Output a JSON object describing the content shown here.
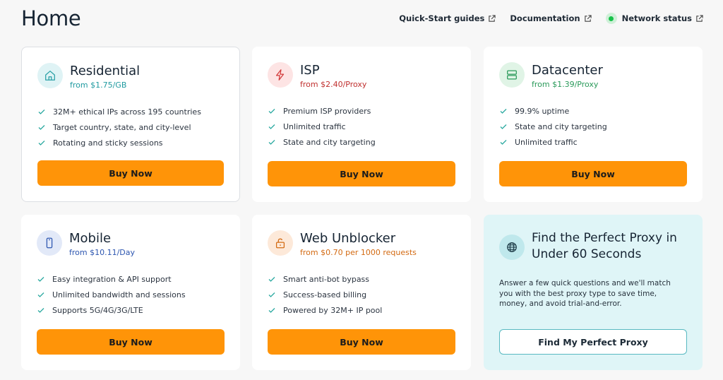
{
  "header": {
    "title": "Home",
    "links": [
      {
        "label": "Quick-Start guides",
        "icon": "external-link-icon"
      },
      {
        "label": "Documentation",
        "icon": "external-link-icon"
      },
      {
        "label": "Network status",
        "icon": "external-link-icon",
        "status_color": "#18c24a"
      }
    ]
  },
  "colors": {
    "accent_orange": "#ff9408",
    "check_teal": "#2aa9a0"
  },
  "cards": [
    {
      "title": "Residential",
      "price": "from $1.75/GB",
      "price_color": "#1f9aa0",
      "icon": "home-icon",
      "features": [
        "32M+ ethical IPs across 195 countries",
        "Target country, state, and city-level",
        "Rotating and sticky sessions"
      ],
      "button": "Buy Now"
    },
    {
      "title": "ISP",
      "price": "from $2.40/Proxy",
      "price_color": "#c0302f",
      "icon": "lightning-icon",
      "features": [
        "Premium ISP providers",
        "Unlimited traffic",
        "State and city targeting"
      ],
      "button": "Buy Now"
    },
    {
      "title": "Datacenter",
      "price": "from $1.39/Proxy",
      "price_color": "#2a9a5a",
      "icon": "server-icon",
      "features": [
        "99.9% uptime",
        "State and city targeting",
        "Unlimited traffic"
      ],
      "button": "Buy Now"
    },
    {
      "title": "Mobile",
      "price": "from $10.11/Day",
      "price_color": "#2d56b0",
      "icon": "mobile-phone-icon",
      "features": [
        "Easy integration & API support",
        "Unlimited bandwidth and sessions",
        "Supports 5G/4G/3G/LTE"
      ],
      "button": "Buy Now"
    },
    {
      "title": "Web Unblocker",
      "price": "from $0.70 per 1000 requests",
      "price_color": "#d36a12",
      "icon": "unlock-icon",
      "features": [
        "Smart anti-bot bypass",
        "Success-based billing",
        "Powered by 32M+ IP pool"
      ],
      "button": "Buy Now"
    }
  ],
  "finder": {
    "title": "Find the Perfect Proxy in Under 60 Seconds",
    "description": "Answer a few quick questions and we'll match you with the best proxy type to save time, money, and avoid trial-and-error.",
    "button": "Find My Perfect Proxy",
    "icon": "globe-icon"
  }
}
